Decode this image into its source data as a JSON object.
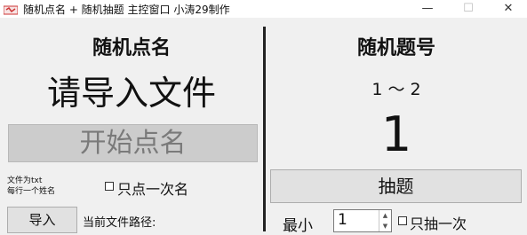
{
  "window": {
    "title": "随机点名 + 随机抽题  主控窗口  小涛29制作",
    "minimize_glyph": "—",
    "maximize_glyph": "☐",
    "close_glyph": "✕"
  },
  "left": {
    "title": "随机点名",
    "file_prompt": "请导入文件",
    "start_button": "开始点名",
    "hint_line1": "文件为txt",
    "hint_line2": "每行一个姓名",
    "once_checkbox": {
      "label": "只点一次名",
      "checked": false
    },
    "import_button": "导入",
    "path_label": "当前文件路径:"
  },
  "right": {
    "title": "随机题号",
    "range": "1 ～ 2",
    "current_number": "1",
    "draw_button": "抽题",
    "min_label": "最小",
    "min_value": "1",
    "once_checkbox": {
      "label": "只抽一次",
      "checked": false
    }
  }
}
